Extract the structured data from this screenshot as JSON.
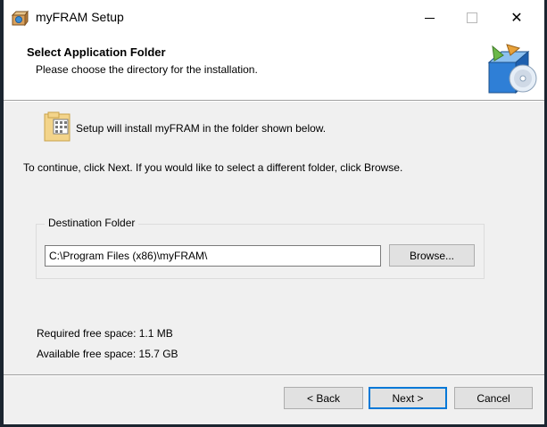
{
  "window": {
    "title": "myFRAM Setup",
    "close_glyph": "✕"
  },
  "header": {
    "title": "Select Application Folder",
    "subtitle": "Please choose the directory for the installation."
  },
  "body": {
    "intro": "Setup will install myFRAM in the folder shown below.",
    "instructions": "To continue, click Next. If you would like to select a different folder, click Browse.",
    "destination": {
      "group_label": "Destination Folder",
      "path_value": "C:\\Program Files (x86)\\myFRAM\\",
      "browse_label": "Browse..."
    },
    "space": {
      "required": "Required free space: 1.1 MB",
      "available": "Available free space: 15.7 GB"
    }
  },
  "footer": {
    "back_label": "< Back",
    "next_label": "Next >",
    "cancel_label": "Cancel"
  },
  "icons": {
    "app": "setup-box-icon",
    "folder": "folder-icon",
    "header": "install-disc-box-icon"
  },
  "colors": {
    "focus_accent": "#0078d7",
    "panel": "#f0f0f0",
    "header_bg": "#ffffff"
  }
}
